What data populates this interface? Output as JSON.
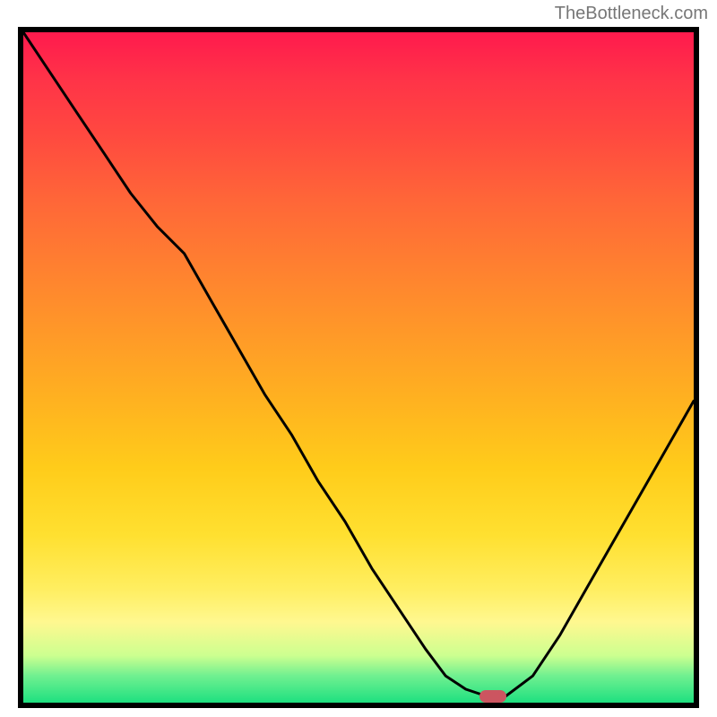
{
  "attribution": "TheBottleneck.com",
  "chart_data": {
    "type": "line",
    "title": "",
    "xlabel": "",
    "ylabel": "",
    "xlim": [
      0,
      1
    ],
    "ylim": [
      0,
      1
    ],
    "x": [
      0.0,
      0.04,
      0.08,
      0.12,
      0.16,
      0.2,
      0.24,
      0.28,
      0.32,
      0.36,
      0.4,
      0.44,
      0.48,
      0.52,
      0.56,
      0.6,
      0.63,
      0.66,
      0.69,
      0.72,
      0.76,
      0.8,
      0.84,
      0.88,
      0.92,
      0.96,
      1.0
    ],
    "values": [
      1.0,
      0.94,
      0.88,
      0.82,
      0.76,
      0.71,
      0.67,
      0.6,
      0.53,
      0.46,
      0.4,
      0.33,
      0.27,
      0.2,
      0.14,
      0.08,
      0.04,
      0.02,
      0.01,
      0.01,
      0.04,
      0.1,
      0.17,
      0.24,
      0.31,
      0.38,
      0.45
    ],
    "marker": {
      "x": 0.7,
      "y": 0.01
    },
    "background": {
      "stops": [
        {
          "pos": 0.0,
          "color": "#ff1a4d"
        },
        {
          "pos": 0.5,
          "color": "#ffb220"
        },
        {
          "pos": 0.88,
          "color": "#fff890"
        },
        {
          "pos": 1.0,
          "color": "#1ee080"
        }
      ]
    }
  }
}
